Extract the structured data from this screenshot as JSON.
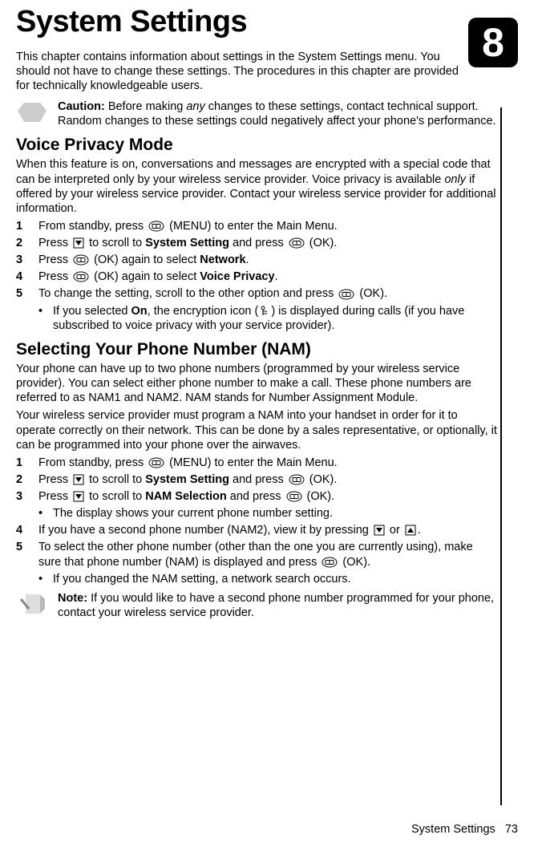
{
  "chapter_number": "8",
  "title": "System Settings",
  "intro": "This chapter contains information about settings in the System Settings menu. You should not have to change these settings. The procedures in this chapter are provided for technically knowledgeable users.",
  "caution": {
    "label": "Caution:",
    "before": " Before making ",
    "any": "any",
    "after": " changes to these settings, contact technical support. Random changes to these settings could negatively affect your phone's performance."
  },
  "voice_privacy": {
    "heading": "Voice Privacy Mode",
    "p1a": "When this feature is on, conversations and messages are encrypted with a special code that can be interpreted only by your wireless service provider. Voice privacy is available ",
    "p1_only": "only",
    "p1b": " if offered by your wireless service provider. Contact your wireless service provider for additional information.",
    "steps": {
      "s1a": "From standby, press ",
      "s1b": " (MENU) to enter the Main Menu.",
      "s2a": "Press ",
      "s2b": " to scroll to ",
      "s2_bold": "System Setting",
      "s2c": " and press ",
      "s2d": " (OK).",
      "s3a": "Press ",
      "s3b": " (OK) again to select ",
      "s3_bold": "Network",
      "s3c": ".",
      "s4a": "Press ",
      "s4b": " (OK) again to select ",
      "s4_bold": "Voice Privacy",
      "s4c": ".",
      "s5a": "To change the setting, scroll to the other option and press ",
      "s5b": " (OK).",
      "sub_a": "If you selected ",
      "sub_on": "On",
      "sub_b": ", the encryption icon (",
      "sub_c": ") is displayed during calls (if you have subscribed to voice privacy with your service provider)."
    }
  },
  "nam": {
    "heading": "Selecting Your Phone Number (NAM)",
    "p1": "Your phone can have up to two phone numbers (programmed by your wireless service provider). You can select either phone number to make a call. These phone numbers are referred to as NAM1 and NAM2. NAM stands for Number Assignment Module.",
    "p2": "Your wireless service provider must program a NAM into your handset in order for it to operate correctly on their network. This can be done by a sales representative, or optionally, it can be programmed into your phone over the airwaves.",
    "steps": {
      "s1a": "From standby, press ",
      "s1b": " (MENU) to enter the Main Menu.",
      "s2a": "Press ",
      "s2b": " to scroll to ",
      "s2_bold": "System Setting",
      "s2c": " and press ",
      "s2d": " (OK).",
      "s3a": "Press ",
      "s3b": " to scroll to ",
      "s3_bold": "NAM Selection",
      "s3c": " and press ",
      "s3d": " (OK).",
      "sub1": "The display shows your current phone number setting.",
      "s4a": "If you have a second phone number (NAM2), view it by pressing ",
      "s4_or": " or ",
      "s4b": ".",
      "s5a": "To select the other phone number (other than the one you are currently using), make sure that phone number (NAM) is displayed and press ",
      "s5b": " (OK).",
      "sub2": "If you changed the NAM setting, a network search occurs."
    }
  },
  "note": {
    "label": "Note:",
    "text": " If you would like to have a second phone number programmed for your phone, contact your wireless service provider."
  },
  "footer": {
    "section": "System Settings",
    "page": "73"
  }
}
